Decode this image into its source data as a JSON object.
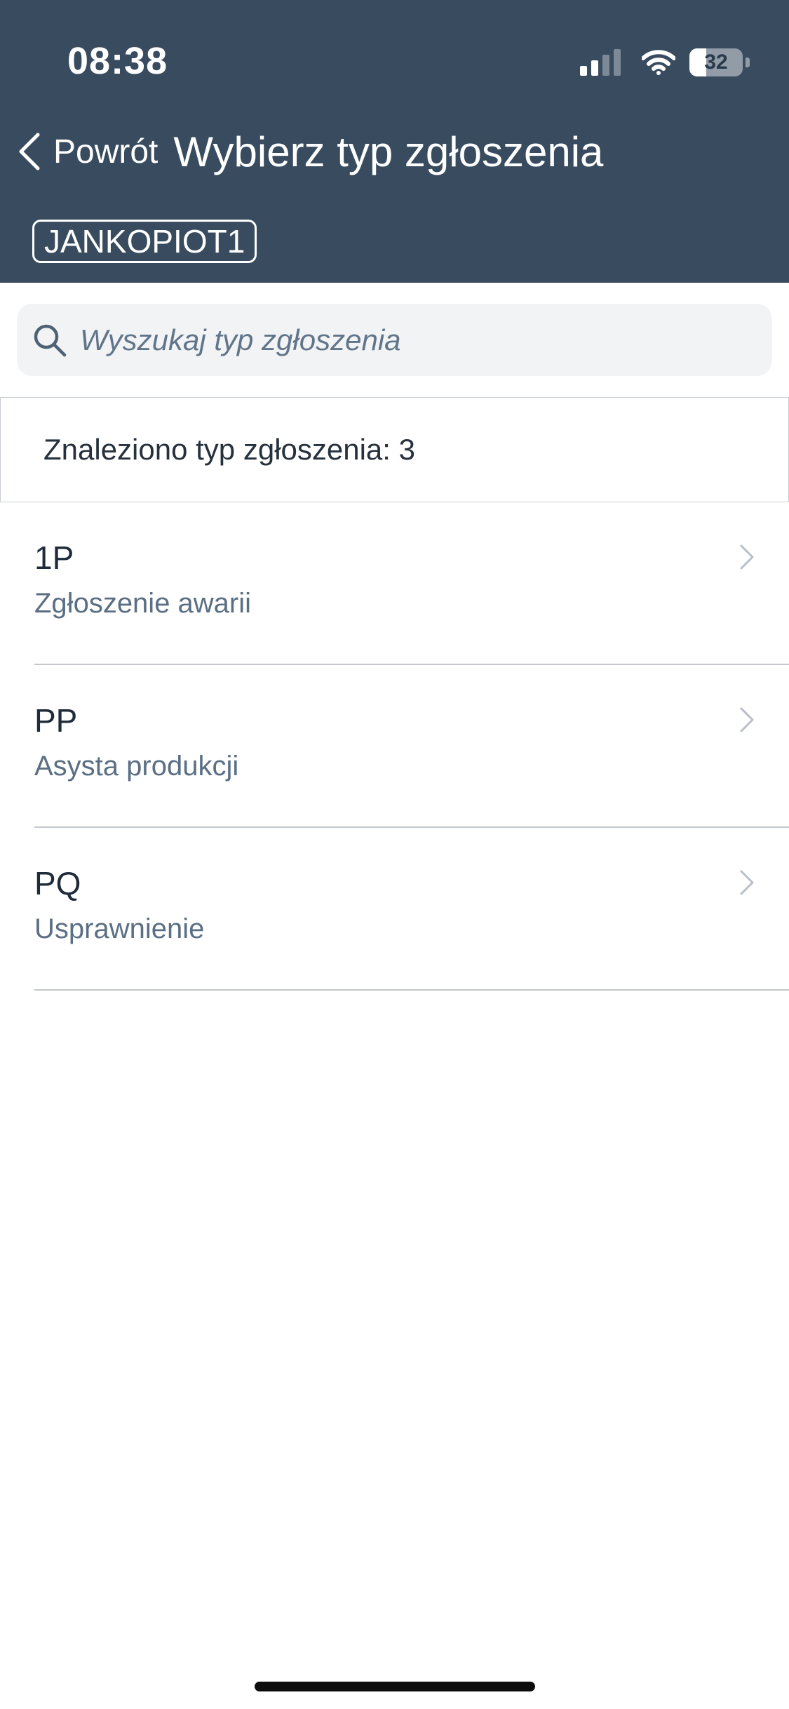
{
  "status_bar": {
    "time": "08:38",
    "battery_level": "32",
    "icons": [
      "signal-icon",
      "wifi-icon",
      "battery-icon"
    ]
  },
  "nav": {
    "back_label": "Powrót",
    "title": "Wybierz typ zgłoszenia",
    "back_icon": "chevron-left-icon"
  },
  "user_badge": "JANKOPIOT1",
  "search": {
    "placeholder": "Wyszukaj typ zgłoszenia",
    "value": "",
    "icon": "search-icon"
  },
  "results": {
    "summary": "Znaleziono typ zgłoszenia: 3"
  },
  "items": [
    {
      "code": "1P",
      "description": "Zgłoszenie awarii"
    },
    {
      "code": "PP",
      "description": "Asysta produkcji"
    },
    {
      "code": "PQ",
      "description": "Usprawnienie"
    }
  ],
  "colors": {
    "header_background": "#384b5f",
    "search_background": "#f1f3f5",
    "description_text": "#5b6f84"
  }
}
